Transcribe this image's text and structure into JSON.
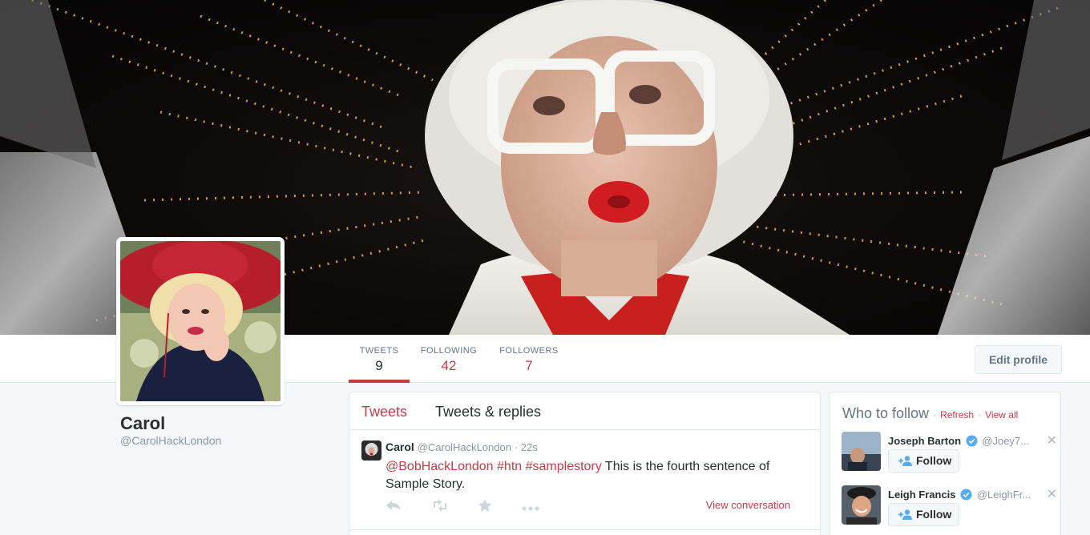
{
  "profile": {
    "name": "Carol",
    "handle": "@CarolHackLondon"
  },
  "stats": [
    {
      "label": "TWEETS",
      "value": "9"
    },
    {
      "label": "FOLLOWING",
      "value": "42"
    },
    {
      "label": "FOLLOWERS",
      "value": "7"
    }
  ],
  "edit_profile_label": "Edit profile",
  "timeline": {
    "tabs": [
      "Tweets",
      "Tweets & replies"
    ],
    "tweet": {
      "name": "Carol",
      "handle": "@CarolHackLondon",
      "time": "· 22s",
      "mention": "@BobHackLondon",
      "hashtag1": "#htn",
      "hashtag2": "#samplestory",
      "text": "This is the fourth sentence of Sample Story.",
      "view_conversation": "View conversation"
    }
  },
  "who_to_follow": {
    "title": "Who to follow",
    "refresh": "Refresh",
    "view_all": "View all",
    "separator": "·",
    "suggestions": [
      {
        "name": "Joseph Barton",
        "handle": "@Joey7...",
        "follow_label": "Follow"
      },
      {
        "name": "Leigh Francis",
        "handle": "@LeighFr...",
        "follow_label": "Follow"
      }
    ],
    "dismiss_glyph": "✕"
  },
  "colors": {
    "accent": "#c73b47",
    "muted": "#8899a6",
    "border": "#e1e8ed",
    "verified": "#55acee"
  }
}
